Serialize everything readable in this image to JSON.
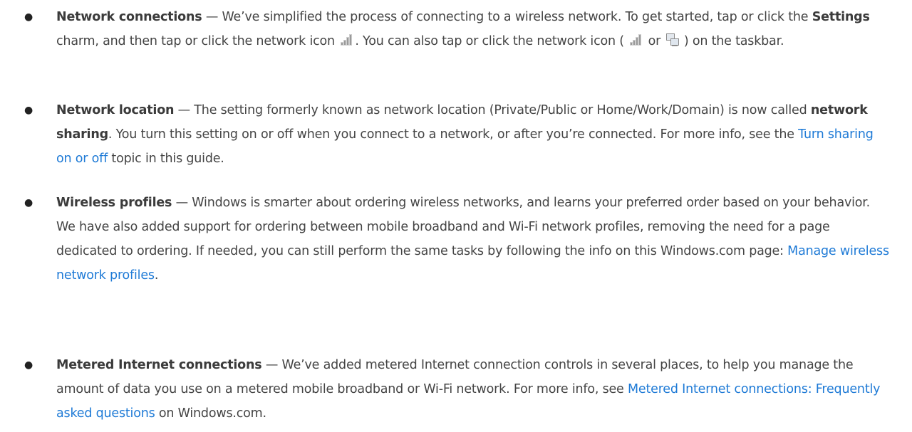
{
  "bullets": [
    {
      "term": "Network connections",
      "text1": " — We’ve simplified the process of connecting to a wireless network. To get started, tap or click the ",
      "strong": "Settings",
      "text2": " charm, and then tap or click the network icon ",
      "text3": ". You can also tap or click the network icon ( ",
      "text4": " or ",
      "text5": " ) on the taskbar.",
      "icons": [
        "network-signal-icon",
        "wired-network-icon"
      ]
    },
    {
      "term": "Network location",
      "text1": " — The setting formerly known as network location (Private/Public or Home/Work/Domain) is now called ",
      "strong": "network sharing",
      "text2": ". You turn this setting on or off when you connect to a network, or after you’re connected. For more info, see the ",
      "link": "Turn sharing on or off",
      "text3": " topic in this guide."
    },
    {
      "term": "Wireless profiles",
      "text1": " — Windows is smarter about ordering wireless networks, and learns your preferred order based on your behavior. We have also added support for ordering between mobile broadband and Wi-Fi network profiles, removing the need for a page dedicated to ordering. If needed, you can still perform the same tasks by following the info on this Windows.com page: ",
      "link": "Manage wireless network profiles",
      "text2": "."
    },
    {
      "term": "Metered Internet connections",
      "text1": " — We’ve added metered Internet connection controls in several places, to help you manage the amount of data you use on a metered mobile broadband or Wi-Fi network. For more info, see ",
      "link": "Metered Internet connections: Frequently asked questions",
      "text2": " on Windows.com."
    }
  ],
  "colors": {
    "text": "#444444",
    "link": "#1e7ad6"
  }
}
